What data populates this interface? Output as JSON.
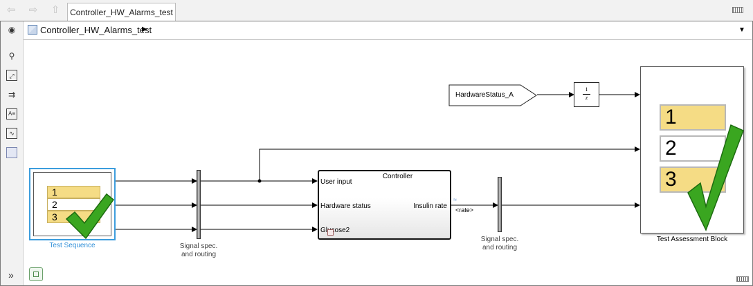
{
  "tab": {
    "label": "Controller_HW_Alarms_test"
  },
  "breadcrumb": {
    "label": "Controller_HW_Alarms_test"
  },
  "icons": [
    "back-arrow-icon",
    "forward-arrow-icon",
    "up-arrow-icon",
    "keyboard-icon",
    "hide-browser-icon",
    "zoom-icon",
    "fit-view-icon",
    "signal-lines-icon",
    "annotation-icon",
    "image-icon",
    "area-icon",
    "expand-icon",
    "model-icon",
    "chevron-right-icon",
    "dropdown-icon",
    "check-icon"
  ],
  "blocks": {
    "test_sequence": {
      "rows": [
        "1",
        "2",
        "3"
      ],
      "label": "Test Sequence"
    },
    "signal_spec_1": {
      "label1": "Signal spec.",
      "label2": "and routing"
    },
    "signal_spec_2": {
      "label1": "Signal spec.",
      "label2": "and routing"
    },
    "controller": {
      "title": "Controller",
      "in1": "User input",
      "in2": "Hardware status",
      "in3": "Glucose2",
      "out1": "Insulin rate"
    },
    "rate_signal": {
      "label": "<rate>"
    },
    "hardware_status": {
      "label": "HardwareStatus_A"
    },
    "unit_delay": {
      "num": "1",
      "den": "z"
    },
    "test_assessment": {
      "rows": [
        "1",
        "2",
        "3"
      ],
      "label": "Test Assessment Block"
    }
  },
  "colors": {
    "selection": "#3c9ddd",
    "table_yellow": "#f5dc85",
    "check_green": "#3aa620",
    "selected_label": "#2f8fd8"
  }
}
